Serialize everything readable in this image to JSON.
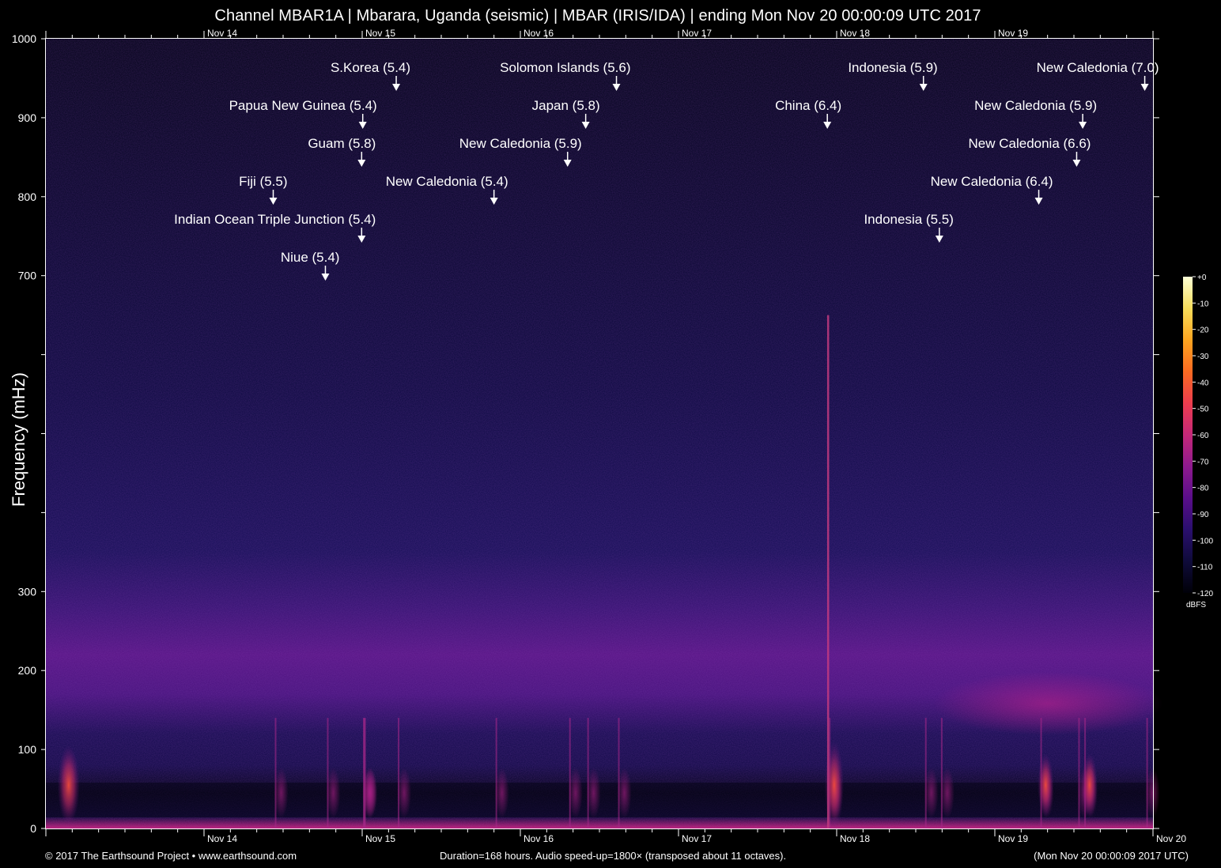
{
  "header": {
    "title": "Channel MBAR1A | Mbarara, Uganda (seismic) | MBAR (IRIS/IDA) | ending Mon Nov 20 00:00:09 UTC 2017"
  },
  "footer": {
    "copyright": "© 2017 The Earthsound Project • www.earthsound.com",
    "duration": "Duration=168 hours. Audio speed-up=1800× (transposed about 11 octaves).",
    "end_time": "(Mon Nov 20 00:00:09 2017 UTC)"
  },
  "chart_data": {
    "type": "heatmap",
    "title": "Channel MBAR1A | Mbarara, Uganda (seismic) | MBAR (IRIS/IDA) | ending Mon Nov 20 00:00:09 UTC 2017",
    "xlabel": "",
    "ylabel": "Frequency (mHz)",
    "x_axis": {
      "type": "time",
      "range": [
        "2017-11-13 00:00",
        "2017-11-20 00:00"
      ],
      "tick_labels": [
        "Nov 14",
        "Nov 15",
        "Nov 16",
        "Nov 17",
        "Nov 18",
        "Nov 19",
        "Nov 20"
      ],
      "top_tick_labels": [
        "Nov 14",
        "Nov 15",
        "Nov 16",
        "Nov 17",
        "Nov 18",
        "Nov 19"
      ]
    },
    "y_axis": {
      "range": [
        0,
        1000
      ],
      "tick_values": [
        0,
        100,
        200,
        300,
        400,
        500,
        600,
        700,
        800,
        900,
        1000
      ],
      "tick_labels": [
        "0",
        "100",
        "200",
        "300",
        "",
        "",
        "",
        "700",
        "800",
        "900",
        "1000"
      ]
    },
    "colorbar": {
      "label": "dBFS",
      "range": [
        -120,
        0
      ],
      "tick_labels": [
        "+0",
        "-10",
        "-20",
        "-30",
        "-40",
        "-50",
        "-60",
        "-70",
        "-80",
        "-90",
        "-100",
        "-110",
        "-120"
      ],
      "colors": [
        "#000008",
        "#0f0b3a",
        "#2a0f6e",
        "#5a0e8a",
        "#8e1a8e",
        "#c52878",
        "#ec3d4e",
        "#fb6a21",
        "#fca520",
        "#f7dd5a",
        "#fcffd6"
      ]
    },
    "events": [
      {
        "label": "S.Korea (5.4)",
        "time": "2017-11-15 05:10"
      },
      {
        "label": "Papua New Guinea (5.4)",
        "time": "2017-11-15 00:05"
      },
      {
        "label": "Guam (5.8)",
        "time": "2017-11-14 23:55"
      },
      {
        "label": "Fiji (5.5)",
        "time": "2017-11-14 10:30"
      },
      {
        "label": "Indian Ocean Triple Junction (5.4)",
        "time": "2017-11-14 23:55"
      },
      {
        "label": "Niue (5.4)",
        "time": "2017-11-14 18:25"
      },
      {
        "label": "Solomon Islands (5.6)",
        "time": "2017-11-16 14:35"
      },
      {
        "label": "Japan (5.8)",
        "time": "2017-11-16 09:55"
      },
      {
        "label": "New Caledonia (5.9)",
        "time": "2017-11-16 07:10"
      },
      {
        "label": "New Caledonia (5.4)",
        "time": "2017-11-15 20:00"
      },
      {
        "label": "China (6.4)",
        "time": "2017-11-17 22:35"
      },
      {
        "label": "Indonesia (5.9)",
        "time": "2017-11-18 13:10"
      },
      {
        "label": "Indonesia (5.5)",
        "time": "2017-11-18 15:35"
      },
      {
        "label": "New Caledonia (7.0)",
        "time": "2017-11-19 22:45"
      },
      {
        "label": "New Caledonia (5.9)",
        "time": "2017-11-19 13:20"
      },
      {
        "label": "New Caledonia (6.6)",
        "time": "2017-11-19 12:25"
      },
      {
        "label": "New Caledonia (6.4)",
        "time": "2017-11-19 06:40"
      }
    ]
  }
}
